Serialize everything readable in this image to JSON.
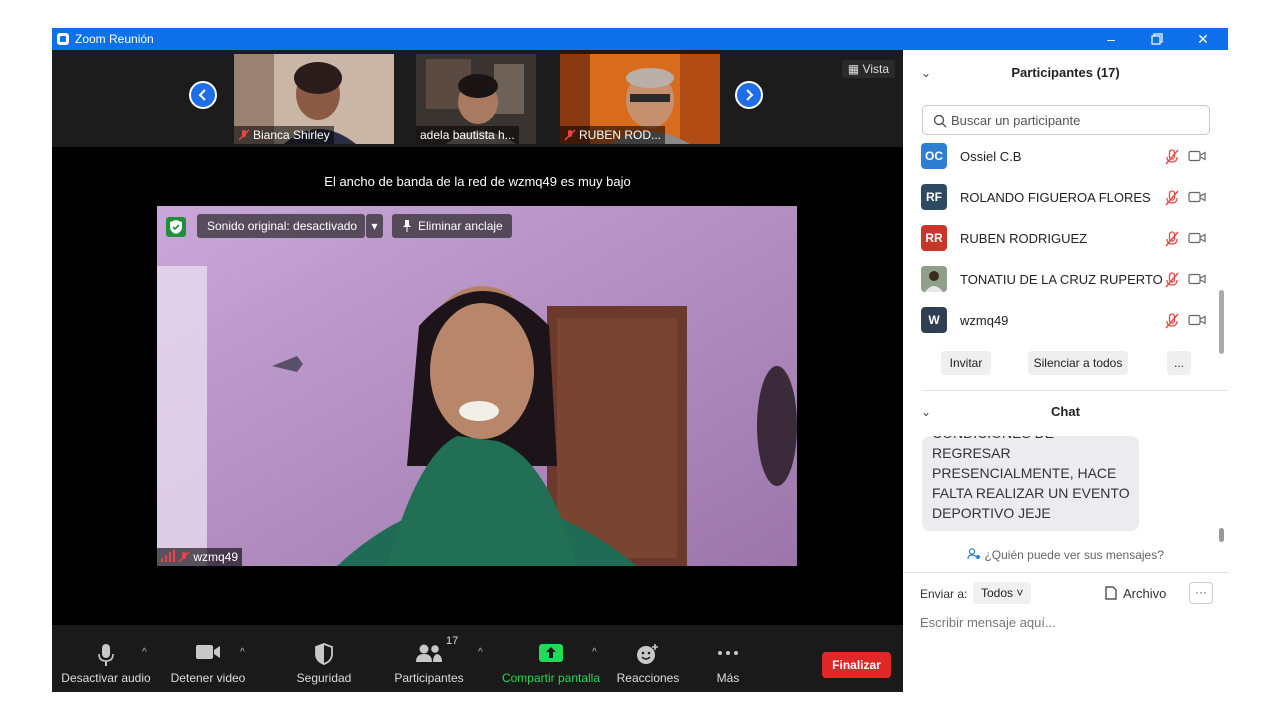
{
  "window": {
    "title": "Zoom Reunión"
  },
  "gallery": {
    "view_label": "Vista",
    "thumbnails": [
      {
        "name": "Bianca Shirley",
        "muted": true
      },
      {
        "name": "adela bautista h...",
        "muted": false
      },
      {
        "name": "RUBEN ROD...",
        "muted": true
      }
    ]
  },
  "bandwidth_notice": "El ancho de banda de la red de wzmq49 es muy bajo",
  "main_video": {
    "sound_label": "Sonido original: desactivado",
    "unpin_label": "Eliminar anclaje",
    "speaker_name": "wzmq49"
  },
  "toolbar": {
    "audio_label": "Desactivar audio",
    "video_label": "Detener video",
    "security_label": "Seguridad",
    "participants_label": "Participantes",
    "participants_count": "17",
    "share_label": "Compartir pantalla",
    "reactions_label": "Reacciones",
    "more_label": "Más",
    "end_label": "Finalizar",
    "share_color": "#23d959",
    "end_color": "#e02828"
  },
  "participants_panel": {
    "title": "Participantes (17)",
    "search_placeholder": "Buscar un participante",
    "list": [
      {
        "initials": "OC",
        "name": "Ossiel C.B",
        "color": "#2e7fd1"
      },
      {
        "initials": "RF",
        "name": "ROLANDO FIGUEROA FLORES",
        "color": "#2e4a62"
      },
      {
        "initials": "RR",
        "name": "RUBEN RODRIGUEZ",
        "color": "#c9352b"
      },
      {
        "initials": "",
        "name": "TONATIU DE LA CRUZ RUPERTO",
        "color": "#5a6b5a"
      },
      {
        "initials": "W",
        "name": "wzmq49",
        "color": "#2e3f52"
      }
    ],
    "invite_label": "Invitar",
    "mute_all_label": "Silenciar a todos",
    "more_label": "..."
  },
  "chat_panel": {
    "title": "Chat",
    "message": "CUANDO ESTEMOS EN CONDICIONES DE REGRESAR PRESENCIALMENTE, HACE FALTA REALIZAR UN EVENTO DEPORTIVO JEJE",
    "who_can_see": "¿Quién puede ver sus mensajes?",
    "send_to_label": "Enviar a:",
    "recipient": "Todos",
    "file_label": "Archivo",
    "more_label": "···",
    "input_placeholder": "Escribir mensaje aquí..."
  }
}
